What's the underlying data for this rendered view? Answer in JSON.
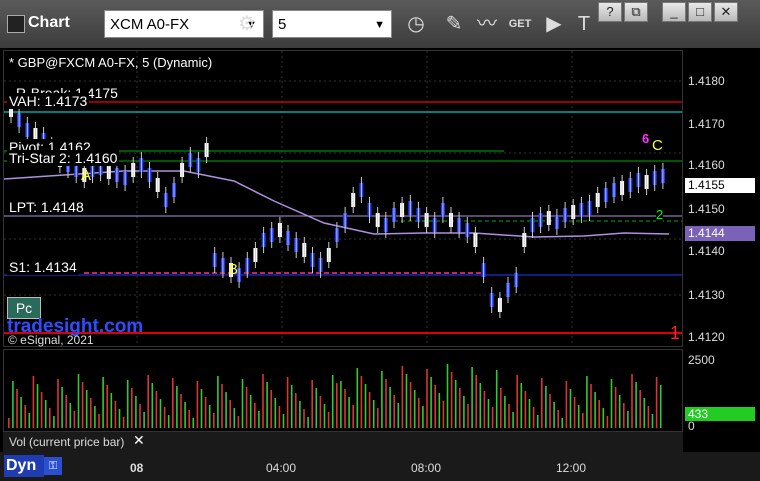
{
  "window": {
    "title": "Chart",
    "symbol_value": "XCM A0-FX",
    "interval_value": "5",
    "controls": {
      "help": "?",
      "restore": "⧉",
      "minimize": "_",
      "maximize": "□",
      "close": "✕"
    }
  },
  "chart": {
    "symbol_title": "* GBP@FXCM A0-FX, 5 (Dynamic)",
    "levels": {
      "r_break": "R-Break: 1.4175",
      "vah": "VAH: 1.4173",
      "pivot": "Pivot: 1.4162",
      "tri_star": "Tri-Star 2: 1.4160",
      "lpt": "LPT: 1.4148",
      "s1": "S1: 1.4134"
    },
    "markers": {
      "a": "A",
      "b": "B",
      "c": "C",
      "one": "1",
      "two": "2"
    },
    "watermark": "tradesight.com",
    "copyright": "© eSignal, 2021",
    "pc_button": "Pc",
    "last_price": "1.4155",
    "ma_price": "1.4144",
    "y_ticks": [
      "1.4180",
      "1.4170",
      "1.4160",
      "1.4150",
      "1.4140",
      "1.4130",
      "1.4120"
    ]
  },
  "volume": {
    "label": "Vol (current price bar)",
    "y_ticks": [
      "2500",
      "0"
    ],
    "last_value": "433"
  },
  "xaxis": {
    "ticks": [
      "08",
      "04:00",
      "08:00",
      "12:00"
    ],
    "mode": "Dyn"
  },
  "colors": {
    "up": "#1e3cff",
    "down": "#ffffff",
    "red_line": "#cc0000",
    "teal_line": "#00c8c8",
    "green_line": "#00aa00",
    "ma_line": "#b090e0",
    "label_yellow": "#ffff33",
    "magenta": "#ff33ff"
  }
}
